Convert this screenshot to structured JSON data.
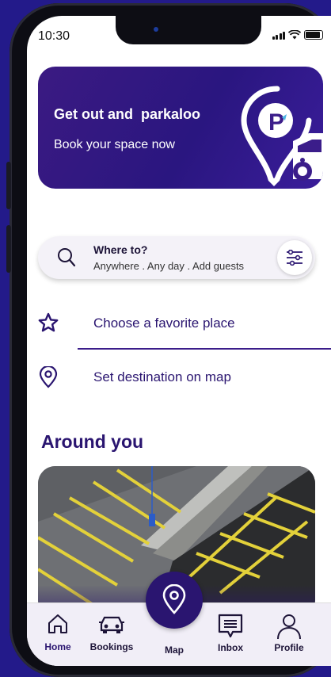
{
  "status_bar": {
    "time": "10:30"
  },
  "banner": {
    "title": "Get out and  parkaloo",
    "subtitle": "Book your space now"
  },
  "search": {
    "title": "Where to?",
    "subtitle": "Anywhere . Any day . Add guests"
  },
  "menu": {
    "favorite_label": "Choose a favorite place",
    "destination_label": "Set destination on map"
  },
  "section": {
    "around_title": "Around you"
  },
  "nav": {
    "home": "Home",
    "bookings": "Bookings",
    "map": "Map",
    "inbox": "Inbox",
    "profile": "Profile"
  },
  "colors": {
    "brand": "#2a1570",
    "background": "#231a8a",
    "parking_lines": "#e3d13a"
  },
  "icons": [
    "search-icon",
    "filter-icon",
    "star-icon",
    "location-pin-icon",
    "home-icon",
    "car-icon",
    "map-pin-icon",
    "inbox-icon",
    "profile-icon"
  ]
}
